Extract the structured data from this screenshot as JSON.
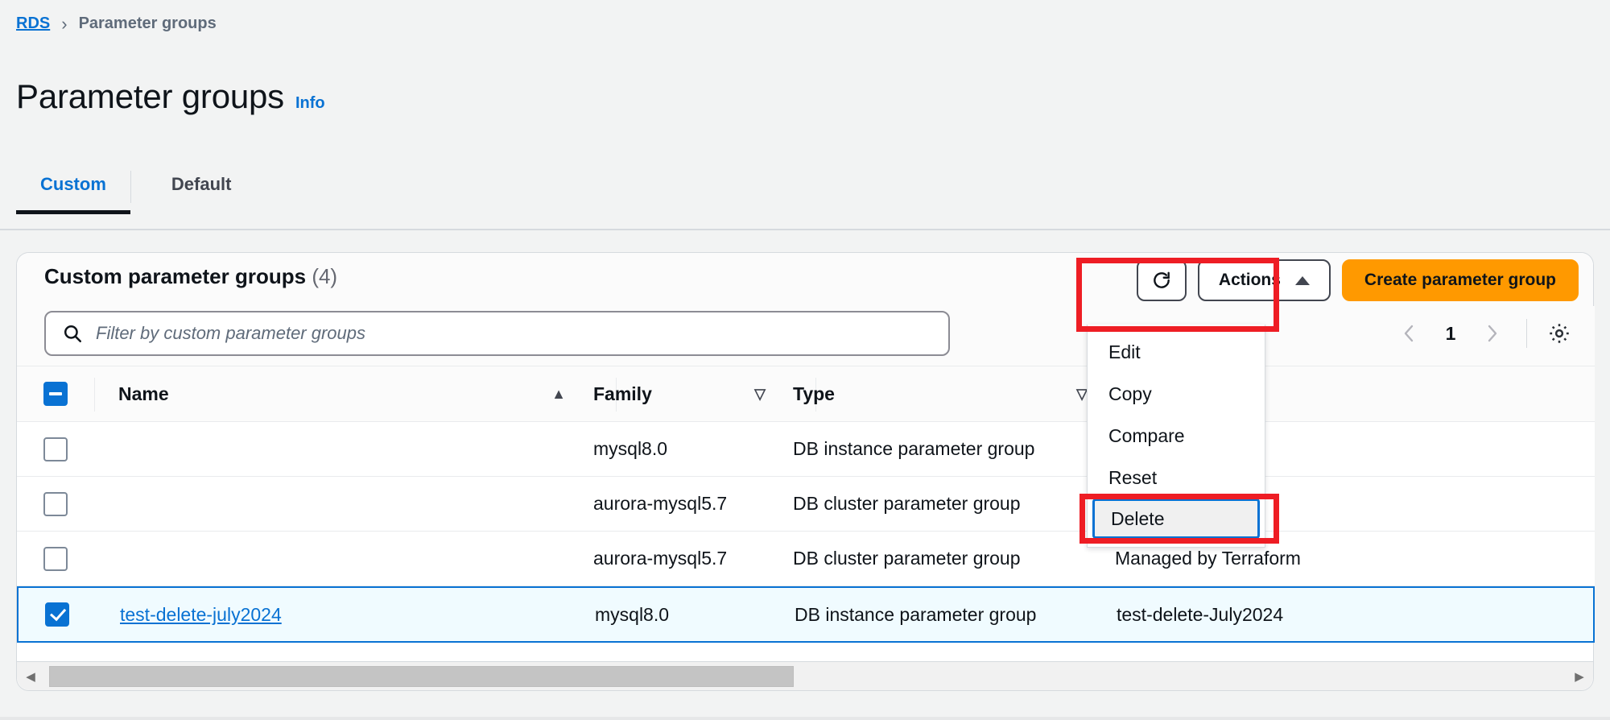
{
  "breadcrumb": {
    "root": "RDS",
    "separator": "›",
    "current": "Parameter groups"
  },
  "header": {
    "title": "Parameter groups",
    "info_label": "Info"
  },
  "tabs": [
    {
      "label": "Custom",
      "active": true
    },
    {
      "label": "Default",
      "active": false
    }
  ],
  "card": {
    "title": "Custom parameter groups",
    "count": "(4)"
  },
  "search": {
    "placeholder": "Filter by custom parameter groups",
    "value": "",
    "icon": "search-icon"
  },
  "toolbar": {
    "refresh_icon": "refresh-icon",
    "actions_label": "Actions",
    "actions_caret": "caret-up-icon",
    "create_label": "Create parameter group",
    "accent_orange": "#ff9900",
    "annotation_color": "#ee1d24"
  },
  "actions_menu": {
    "items": [
      {
        "label": "Edit",
        "focused": false
      },
      {
        "label": "Copy",
        "focused": false
      },
      {
        "label": "Compare",
        "focused": false
      },
      {
        "label": "Reset",
        "focused": false
      },
      {
        "label": "Delete",
        "focused": true
      }
    ]
  },
  "pagination": {
    "prev_icon": "chevron-left-icon",
    "page": "1",
    "next_icon": "chevron-right-icon",
    "settings_icon": "gear-icon"
  },
  "table": {
    "columns": [
      {
        "key": "name",
        "label": "Name",
        "sort": "▲"
      },
      {
        "key": "family",
        "label": "Family",
        "sort": "▽"
      },
      {
        "key": "type",
        "label": "Type",
        "sort": "▽"
      },
      {
        "key": "description",
        "label": "",
        "sort": ""
      }
    ],
    "header_checkbox_state": "indeterminate",
    "rows": [
      {
        "selected": false,
        "checked": false,
        "name": "",
        "family": "mysql8.0",
        "type": "DB instance parameter group",
        "description": ""
      },
      {
        "selected": false,
        "checked": false,
        "name": "",
        "family": "aurora-mysql5.7",
        "type": "DB cluster parameter group",
        "description": "."
      },
      {
        "selected": false,
        "checked": false,
        "name": "",
        "family": "aurora-mysql5.7",
        "type": "DB cluster parameter group",
        "description": "Managed by Terraform"
      },
      {
        "selected": true,
        "checked": true,
        "name": "test-delete-july2024",
        "family": "mysql8.0",
        "type": "DB instance parameter group",
        "description": "test-delete-July2024"
      }
    ]
  },
  "scrollbar": {
    "left_arrow": "scroll-left-arrow",
    "right_arrow": "scroll-right-arrow"
  }
}
